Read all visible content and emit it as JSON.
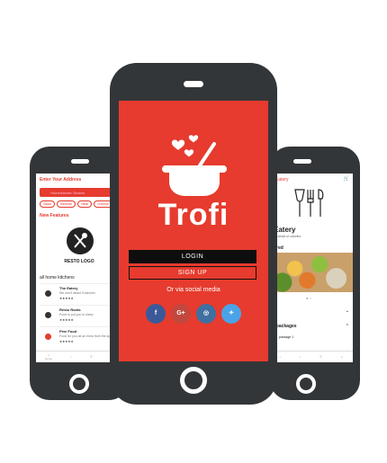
{
  "left_screen": {
    "header": "Enter Your Address",
    "search_placeholder": "Home/kitchen Search",
    "chips": [
      "Salad",
      "Mexican",
      "Halal",
      "Chinese"
    ],
    "featured_label": "New Features",
    "logo_text": "RESTO LOGO",
    "section_label": "all home kitchens",
    "items": [
      {
        "title": "The Eatery",
        "desc": "We won't afraid if calories",
        "stars": "★★★★★"
      },
      {
        "title": "Resto Roots",
        "desc": "Food to put you to sleep",
        "stars": "★★★★★"
      },
      {
        "title": "Fine Food",
        "desc": "Food for you all an extra from the app",
        "stars": "★★★★★"
      }
    ],
    "nav": [
      "Home",
      "",
      "",
      ""
    ]
  },
  "center_screen": {
    "app_name": "Trofi",
    "login_label": "LOGIN",
    "signup_label": "SIGN UP",
    "social_label": "Or via social media",
    "social_icons": [
      {
        "name": "facebook-icon",
        "glyph": "f",
        "color": "#3b5998"
      },
      {
        "name": "google-plus-icon",
        "glyph": "G+",
        "color": "#c2473d"
      },
      {
        "name": "instagram-icon",
        "glyph": "◎",
        "color": "#3e6fa0"
      },
      {
        "name": "twitter-icon",
        "glyph": "🐦",
        "color": "#4aa3e8"
      }
    ],
    "brand_color": "#e63b2e"
  },
  "right_screen": {
    "header": "Eatery",
    "title": "Eatery",
    "subtitle": "n't afraid of calories",
    "featured_label": "ured",
    "rows": [
      "ls",
      "l packages"
    ],
    "package": "package 1"
  }
}
